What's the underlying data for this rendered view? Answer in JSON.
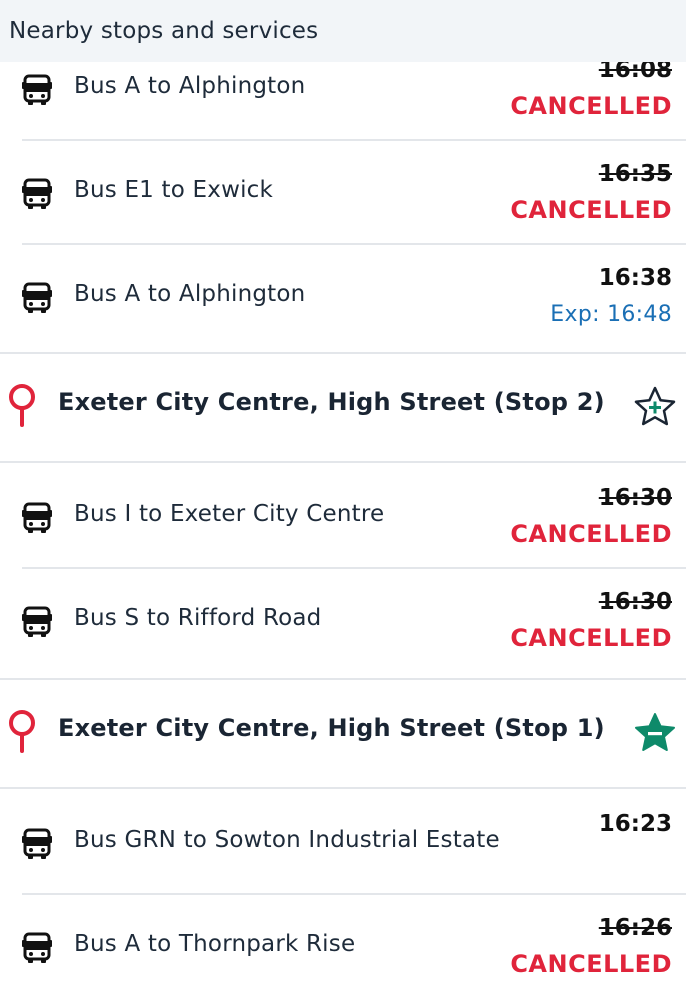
{
  "header": {
    "title": "Nearby stops and services"
  },
  "colors": {
    "cancelled": "#e0243b",
    "expected": "#1a6fb5",
    "favourite": "#0e8a6a",
    "pin": "#e0243b"
  },
  "groups": [
    {
      "services": [
        {
          "route": "Bus A to Alphington",
          "time": "16:08",
          "status": "CANCELLED"
        },
        {
          "route": "Bus E1 to Exwick",
          "time": "16:35",
          "status": "CANCELLED"
        },
        {
          "route": "Bus A to Alphington",
          "time": "16:38",
          "status": "Exp: 16:48"
        }
      ]
    },
    {
      "stop_name": "Exeter City Centre, High Street (Stop 2)",
      "favourite_icon": "star-add-icon",
      "services": [
        {
          "route": "Bus I to Exeter City Centre",
          "time": "16:30",
          "status": "CANCELLED"
        },
        {
          "route": "Bus S to Rifford Road",
          "time": "16:30",
          "status": "CANCELLED"
        }
      ]
    },
    {
      "stop_name": "Exeter City Centre, High Street (Stop 1)",
      "favourite_icon": "star-remove-icon",
      "services": [
        {
          "route": "Bus GRN to Sowton Industrial Estate",
          "time": "16:23",
          "status": ""
        },
        {
          "route": "Bus A to Thornpark Rise",
          "time": "16:26",
          "status": "CANCELLED"
        }
      ]
    }
  ]
}
